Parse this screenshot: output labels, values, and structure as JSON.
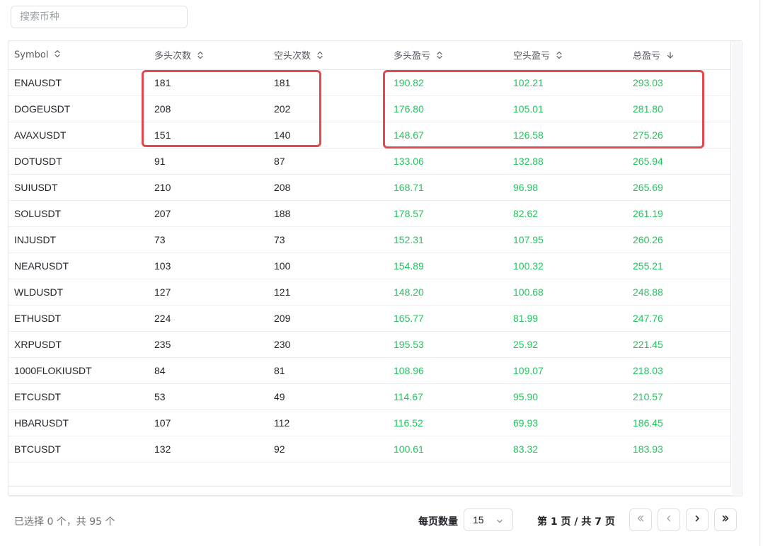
{
  "search": {
    "placeholder": "搜索币种"
  },
  "table": {
    "columns": [
      {
        "label": "Symbol",
        "sort": "none"
      },
      {
        "label": "多头次数",
        "sort": "none"
      },
      {
        "label": "空头次数",
        "sort": "none"
      },
      {
        "label": "多头盈亏",
        "sort": "none"
      },
      {
        "label": "空头盈亏",
        "sort": "none"
      },
      {
        "label": "总盈亏",
        "sort": "desc"
      }
    ],
    "rows": [
      [
        "ENAUSDT",
        "181",
        "181",
        "190.82",
        "102.21",
        "293.03"
      ],
      [
        "DOGEUSDT",
        "208",
        "202",
        "176.80",
        "105.01",
        "281.80"
      ],
      [
        "AVAXUSDT",
        "151",
        "140",
        "148.67",
        "126.58",
        "275.26"
      ],
      [
        "DOTUSDT",
        "91",
        "87",
        "133.06",
        "132.88",
        "265.94"
      ],
      [
        "SUIUSDT",
        "210",
        "208",
        "168.71",
        "96.98",
        "265.69"
      ],
      [
        "SOLUSDT",
        "207",
        "188",
        "178.57",
        "82.62",
        "261.19"
      ],
      [
        "INJUSDT",
        "73",
        "73",
        "152.31",
        "107.95",
        "260.26"
      ],
      [
        "NEARUSDT",
        "103",
        "100",
        "154.89",
        "100.32",
        "255.21"
      ],
      [
        "WLDUSDT",
        "127",
        "121",
        "148.20",
        "100.68",
        "248.88"
      ],
      [
        "ETHUSDT",
        "224",
        "209",
        "165.77",
        "81.99",
        "247.76"
      ],
      [
        "XRPUSDT",
        "235",
        "230",
        "195.53",
        "25.92",
        "221.45"
      ],
      [
        "1000FLOKIUSDT",
        "84",
        "81",
        "108.96",
        "109.07",
        "218.03"
      ],
      [
        "ETCUSDT",
        "53",
        "49",
        "114.67",
        "95.90",
        "210.57"
      ],
      [
        "HBARUSDT",
        "107",
        "112",
        "116.52",
        "69.93",
        "186.45"
      ],
      [
        "BTCUSDT",
        "132",
        "92",
        "100.61",
        "83.32",
        "183.93"
      ]
    ]
  },
  "footer": {
    "selection_info": "已选择 0 个，共 95 个",
    "page_size_label": "每页数量",
    "page_size_value": "15",
    "page_info": "第 1 页 / 共 7 页"
  },
  "colors": {
    "profit": "#22c55e",
    "highlight": "#e5484d"
  },
  "icons": {
    "sort_none": "chevron-up-down-icon",
    "sort_desc": "arrow-down-icon",
    "first": "double-chevron-left-icon",
    "prev": "chevron-left-icon",
    "next": "chevron-right-icon",
    "last": "double-chevron-right-icon",
    "select": "chevron-down-icon"
  }
}
